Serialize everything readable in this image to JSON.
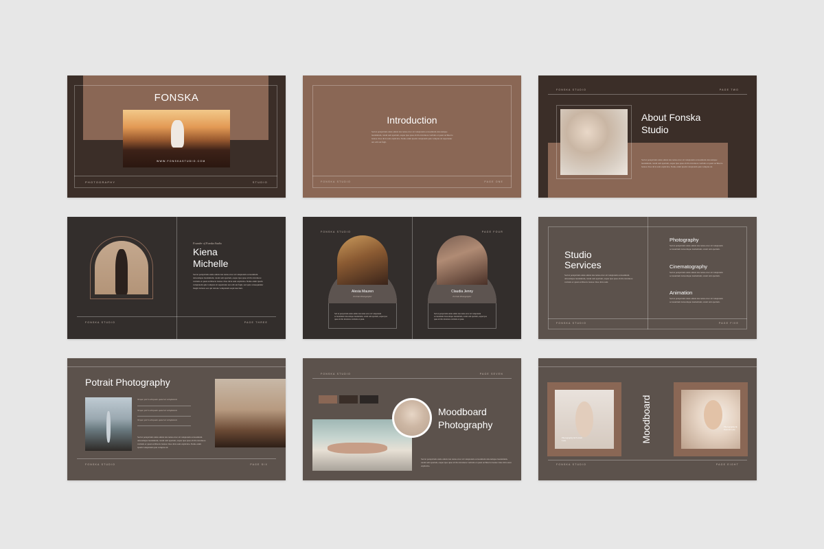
{
  "slides": {
    "s1": {
      "title": "FONSKA",
      "website": "WWW.FONSKASTUDIO.COM",
      "footer_left": "PHOTOGRAPHY",
      "footer_right": "STUDIO"
    },
    "s2": {
      "title": "Introduction",
      "footer_left": "FONSKA STUDIO",
      "footer_right": "PAGE ONE",
      "body": "Sed ut perspiciatis unde omnis iste natus error sit voluptatem accusantium doloremque laudantium, totam rem aperiam, eaque ipsa quae ab illo inventore veritatis et quasi architecto beatae vitae dicta sunt explicabo. Nemo enim ipsam voluptatem quia voluptas sit aspernatur aut odit aut fugit."
    },
    "s3": {
      "title_line1": "About Fonska",
      "title_line2": "Studio",
      "header_left": "FONSKA STUDIO",
      "header_right": "PAGE TWO",
      "body": "Sed ut perspiciatis unde omnis iste natus error sit voluptatem accusantium doloremque laudantium, totam rem aperiam, eaque ipsa quae ab illo inventore veritatis et quasi architecto beatae vitae dicta sunt explicabo. Nemo enim ipsam voluptatem quia voluptas sit."
    },
    "s4": {
      "subtitle": "Founder of Fonska Studio",
      "name_line1": "Kiena",
      "name_line2": "Michelle",
      "footer_left": "FONSKA STUDIO",
      "footer_right": "PAGE THREE",
      "body": "Sed ut perspiciatis unde omnis iste natus error sit voluptatem accusantium doloremque laudantium, totam rem aperiam, eaque ipsa quae ab illo inventore veritatis et quasi architecto beatae vitae dicta sunt explicabo. Nemo enim ipsam voluptatem quia voluptas sit aspernatur aut odit aut fugit, sed quia consequuntur magni dolores eos qui ratione voluptatem sequi nesciunt."
    },
    "s5": {
      "header_left": "FONSKA STUDIO",
      "header_right": "PAGE FOUR",
      "person1": {
        "name": "Alesia Mauren",
        "role": "Portrait Photographer"
      },
      "person2": {
        "name": "Claudia Jenny",
        "role": "Portrait Photographer"
      },
      "body": "Sed ut perspiciatis unde omnis iste natus error sit voluptatem accusantium doloremque laudantium, totam rem aperiam, eaque ipsa quae ab illo inventore veritatis et quasi."
    },
    "s6": {
      "title_line1": "Studio",
      "title_line2": "Services",
      "footer_left": "FONSKA STUDIO",
      "footer_right": "PAGE FIVE",
      "body": "Sed ut perspiciatis unde omnis iste natus error sit voluptatem accusantium doloremque laudantium, totam rem aperiam, eaque ipsa quae ab illo inventore veritatis et quasi architecto beatae vitae dicta sunt.",
      "services": [
        {
          "title": "Photography",
          "body": "Sed ut perspiciatis unde omnis iste natus error sit voluptatem accusantium doloremque laudantium, totam rem aperiam."
        },
        {
          "title": "Cinematography",
          "body": "Sed ut perspiciatis unde omnis iste natus error sit voluptatem accusantium doloremque laudantium, totam rem aperiam."
        },
        {
          "title": "Animation",
          "body": "Sed ut perspiciatis unde omnis iste natus error sit voluptatem accusantium doloremque laudantium, totam rem aperiam."
        }
      ]
    },
    "s7": {
      "title": "Potrait Photography",
      "footer_left": "FONSKA STUDIO",
      "footer_right": "PAGE SIX",
      "bullets": [
        "Neque porro aliquam quaerat voluptatem",
        "Neque porro aliquam quaerat voluptatem",
        "Neque porro aliquam quaerat voluptatem"
      ],
      "body": "Sed ut perspiciatis unde omnis iste natus error sit voluptatem accusantium doloremque laudantium, totam rem aperiam, eaque ipsa quae ab illo inventore veritatis et quasi architecto beatae vitae dicta sunt explicabo. Nemo enim ipsam voluptatem quia voluptas sit."
    },
    "s8": {
      "title_line1": "Moodboard",
      "title_line2": "Photography",
      "header_left": "FONSKA STUDIO",
      "header_right": "PAGE SEVEN",
      "swatches": [
        "#8a6755",
        "#3a2e28",
        "#2c2725"
      ],
      "body": "Sed ut perspiciatis unde omnis iste natus error sit voluptatem accusantium doloremque laudantium, totam rem aperiam, eaque ipsa quae ab illo inventore veritatis et quasi architecto beatae vitae dicta sunt explicabo."
    },
    "s9": {
      "title": "Moodboard",
      "caption1": "Photography & Portrait Lens",
      "caption2": "Photography & Portrait Lens",
      "footer_left": "FONSKA STUDIO",
      "footer_right": "PAGE EIGHT"
    }
  },
  "colors": {
    "page_bg": "#e7e7e7",
    "dark_brown": "#3b2e28",
    "mocha": "#8a6755",
    "charcoal": "#332e2c",
    "taupe": "#5c524c"
  }
}
